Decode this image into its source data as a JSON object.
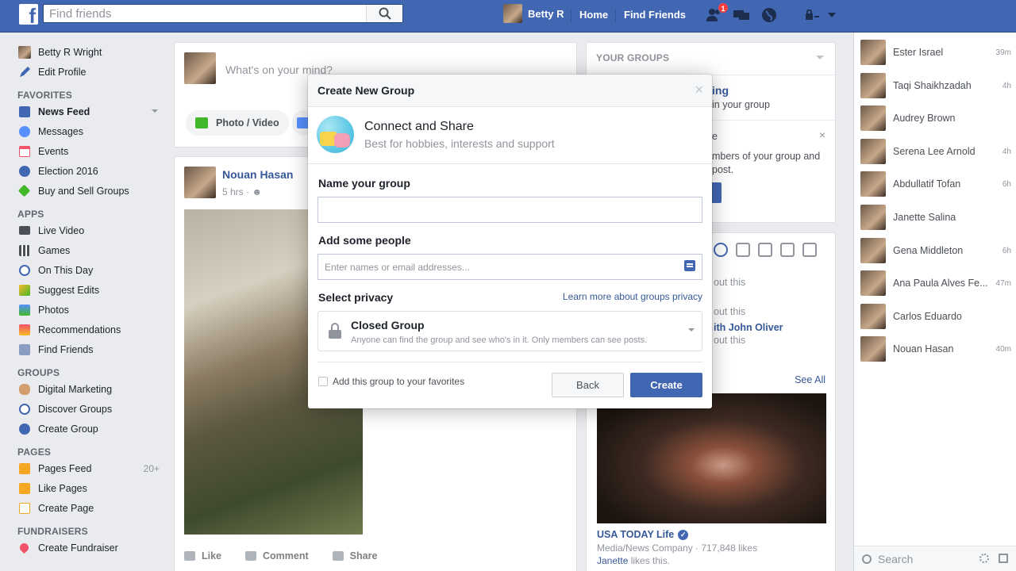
{
  "topbar": {
    "search_placeholder": "Find friends",
    "user_name": "Betty R",
    "home": "Home",
    "find_friends": "Find Friends",
    "friend_requests_badge": "1"
  },
  "left_nav": {
    "profile_name": "Betty R Wright",
    "edit_profile": "Edit Profile",
    "favorites_head": "FAVORITES",
    "favorites": [
      "News Feed",
      "Messages",
      "Events",
      "Election 2016",
      "Buy and Sell Groups"
    ],
    "apps_head": "APPS",
    "apps": [
      "Live Video",
      "Games",
      "On This Day",
      "Suggest Edits",
      "Photos",
      "Recommendations",
      "Find Friends"
    ],
    "groups_head": "GROUPS",
    "groups": [
      "Digital Marketing",
      "Discover Groups",
      "Create Group"
    ],
    "pages_head": "PAGES",
    "pages": [
      "Pages Feed",
      "Like Pages",
      "Create Page"
    ],
    "pages_feed_count": "20+",
    "fundraisers_head": "FUNDRAISERS",
    "fundraisers": [
      "Create Fundraiser"
    ]
  },
  "composer": {
    "placeholder": "What's on your mind?",
    "photo_video": "Photo / Video"
  },
  "post": {
    "author": "Nouan Hasan",
    "time": "5 hrs",
    "like": "Like",
    "comment": "Comment",
    "share": "Share"
  },
  "your_groups": {
    "head": "YOUR GROUPS",
    "line1": "ing",
    "line2": "in your group",
    "line3": "e",
    "line4": "mbers of your group and",
    "line5": "post."
  },
  "trending": {
    "lines": [
      "out this",
      "out this",
      "ith John Oliver",
      "out this"
    ],
    "see_all": "See All",
    "page_name": "USA TODAY Life",
    "page_category": "Media/News Company · 717,848 likes",
    "likes_by": "Janette",
    "likes_suffix": " likes this."
  },
  "chat": {
    "contacts": [
      {
        "name": "Ester Israel",
        "time": "39m"
      },
      {
        "name": "Taqi Shaikhzadah",
        "time": "4h"
      },
      {
        "name": "Audrey Brown",
        "time": ""
      },
      {
        "name": "Serena Lee Arnold",
        "time": "4h"
      },
      {
        "name": "Abdullatif Tofan",
        "time": "6h"
      },
      {
        "name": "Janette Salina",
        "time": ""
      },
      {
        "name": "Gena Middleton",
        "time": "6h"
      },
      {
        "name": "Ana Paula Alves Fe...",
        "time": "47m"
      },
      {
        "name": "Carlos Eduardo",
        "time": ""
      },
      {
        "name": "Nouan Hasan",
        "time": "40m"
      }
    ],
    "search_placeholder": "Search"
  },
  "modal": {
    "title": "Create New Group",
    "close": "×",
    "type_title": "Connect and Share",
    "type_sub": "Best for hobbies, interests and support",
    "name_label": "Name your group",
    "name_value": "",
    "people_label": "Add some people",
    "people_placeholder": "Enter names or email addresses...",
    "privacy_label": "Select privacy",
    "privacy_link": "Learn more about groups privacy",
    "privacy_title": "Closed Group",
    "privacy_desc": "Anyone can find the group and see who's in it. Only members can see posts.",
    "favorites_check": "Add this group to your favorites",
    "back": "Back",
    "create": "Create"
  },
  "colors": {
    "brand": "#4267b2",
    "link": "#365899",
    "muted": "#90949c",
    "badge": "#fa3e3e"
  }
}
